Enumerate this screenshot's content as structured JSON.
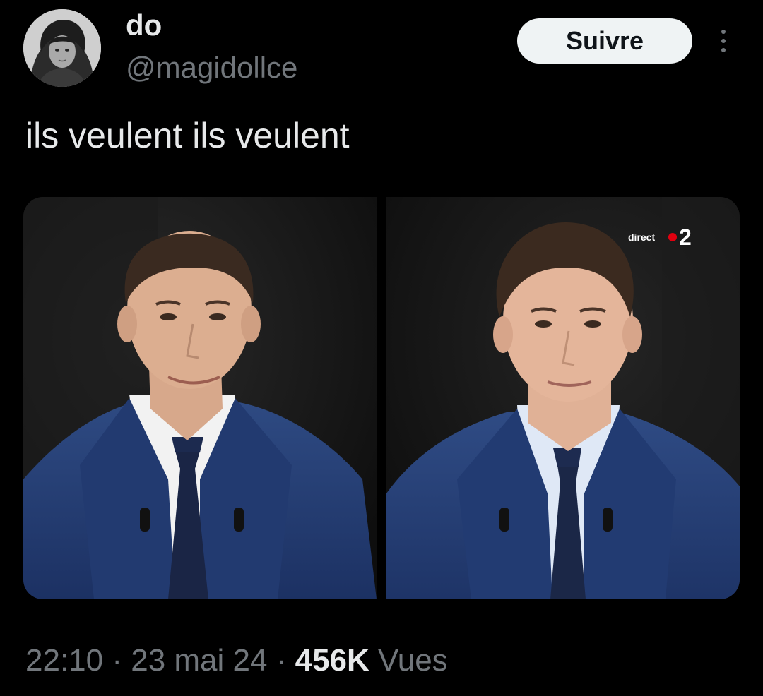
{
  "user": {
    "display_name": "do",
    "handle": "@magidollce",
    "avatar_icon": "profile-photo"
  },
  "actions": {
    "follow_label": "Suivre",
    "more_icon": "more-vertical-icon"
  },
  "tweet": {
    "text": "ils veulent ils veulent"
  },
  "media": {
    "overlay_text": "direct",
    "overlay_channel": "2",
    "overlay_dot_color": "#e1000f"
  },
  "meta": {
    "time": "22:10",
    "separator": "·",
    "date": "23 mai 24",
    "views_count": "456K",
    "views_label": "Vues"
  }
}
